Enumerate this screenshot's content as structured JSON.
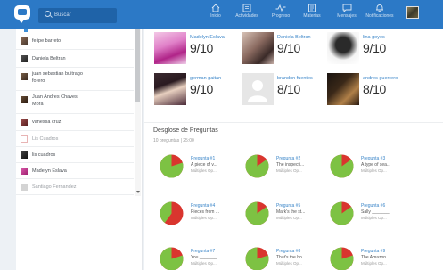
{
  "topbar": {
    "search_placeholder": "Buscar",
    "nav": [
      {
        "label": "Inicio",
        "icon": "home-icon"
      },
      {
        "label": "Actividades",
        "icon": "activities-icon"
      },
      {
        "label": "Progreso",
        "icon": "progress-icon"
      },
      {
        "label": "Materias",
        "icon": "subjects-icon"
      },
      {
        "label": "Mensajes",
        "icon": "messages-icon"
      },
      {
        "label": "Notificaciones",
        "icon": "bell-icon"
      }
    ]
  },
  "contacts": [
    {
      "name": "felipe barreto",
      "muted": false,
      "color": "#6e5a4a"
    },
    {
      "name": "Daniela Beltran",
      "muted": false,
      "color": "#3a3a3a"
    },
    {
      "name": "juan sebastian buitrago",
      "name2": "forero",
      "muted": false,
      "color": "#5a4a3a"
    },
    {
      "name": "Juan Andres Chaves",
      "name2": "Mora",
      "muted": false,
      "color": "#4a3a2a"
    },
    {
      "name": "vanessa cruz",
      "muted": false,
      "color": "#7a3a3a"
    },
    {
      "name": "Lis Cuadros",
      "muted": true,
      "color": "#e8b4b4"
    },
    {
      "name": "lis cuadros",
      "muted": false,
      "color": "#2a2a2a"
    },
    {
      "name": "Madelyn Eslava",
      "muted": false,
      "color": "#d0449a"
    },
    {
      "name": "Santiago Fernandez",
      "muted": true,
      "color": "#cfcfcf"
    }
  ],
  "results": [
    {
      "name": "Madelyn Eslava",
      "score": "9/10"
    },
    {
      "name": "Daniela Beltran",
      "score": "9/10"
    },
    {
      "name": "lina goyes",
      "score": "9/10"
    },
    {
      "name": "german gaitan",
      "score": "9/10"
    },
    {
      "name": "brandon fuentes",
      "score": "8/10"
    },
    {
      "name": "andres guerrero",
      "score": "8/10"
    }
  ],
  "breakdown": {
    "title": "Desglose de Preguntas",
    "subtitle": "10 preguntas | 25:00"
  },
  "questions": [
    {
      "title": "Pregunta #1",
      "snippet": "A piece of v...",
      "kind": "Múltiples Op...",
      "correct": 0.8
    },
    {
      "title": "Pregunta #2",
      "snippet": "The inspecti...",
      "kind": "Múltiples Op...",
      "correct": 0.85
    },
    {
      "title": "Pregunta #3",
      "snippet": "A type of sea...",
      "kind": "Múltiples Op...",
      "correct": 0.85
    },
    {
      "title": "Pregunta #4",
      "snippet": "Pieces from ...",
      "kind": "Múltiples Op...",
      "correct": 0.4
    },
    {
      "title": "Pregunta #5",
      "snippet": "Mark's the st...",
      "kind": "Múltiples Op...",
      "correct": 0.85
    },
    {
      "title": "Pregunta #6",
      "snippet": "Sally _______",
      "kind": "Múltiples Op...",
      "correct": 0.85
    },
    {
      "title": "Pregunta #7",
      "snippet": "You _______",
      "kind": "Múltiples Op...",
      "correct": 0.8
    },
    {
      "title": "Pregunta #8",
      "snippet": "That's the bo...",
      "kind": "Múltiples Op...",
      "correct": 0.8
    },
    {
      "title": "Pregunta #9",
      "snippet": "The Amazon...",
      "kind": "Múltiples Op...",
      "correct": 0.8
    }
  ],
  "colors": {
    "brand": "#2c79c6",
    "correct": "#7dc243",
    "incorrect": "#d9352e"
  }
}
